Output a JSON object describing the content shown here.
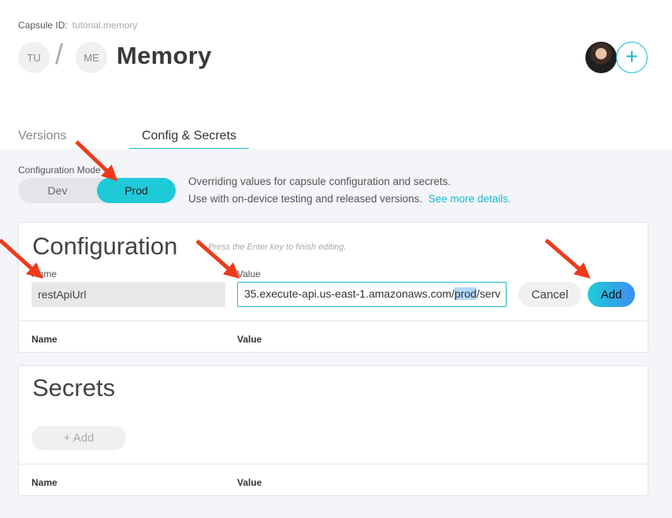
{
  "header": {
    "capsule_id_label": "Capsule ID:",
    "capsule_id_value": "tutorial.memory",
    "crumb_1": "TU",
    "crumb_sep": "/",
    "crumb_2": "ME",
    "title": "Memory",
    "add_collaborator": "+"
  },
  "tabs": [
    {
      "label": "Versions",
      "active": false
    },
    {
      "label": "Config & Secrets",
      "active": true
    }
  ],
  "mode": {
    "label": "Configuration Mode",
    "options": [
      "Dev",
      "Prod"
    ],
    "selected": "Prod",
    "desc_line1": "Overriding values for capsule configuration and secrets.",
    "desc_line2": "Use with on-device testing and released versions.",
    "desc_link": "See more details."
  },
  "configuration": {
    "title": "Configuration",
    "hint": "Press the Enter key to finish editing.",
    "name_label": "Name",
    "value_label": "Value",
    "name_value": "restApiUrl",
    "value_before": "35.execute-api.us-east-1.amazonaws.com/",
    "value_selected": "prod",
    "value_after": "/serv",
    "cancel": "Cancel",
    "add": "Add",
    "col_name": "Name",
    "col_value": "Value"
  },
  "secrets": {
    "title": "Secrets",
    "add": "+ Add",
    "col_name": "Name",
    "col_value": "Value"
  },
  "colors": {
    "accent": "#1ab7cf",
    "toggle_active": "#1fcad8",
    "arrow": "#ee3a1c"
  }
}
